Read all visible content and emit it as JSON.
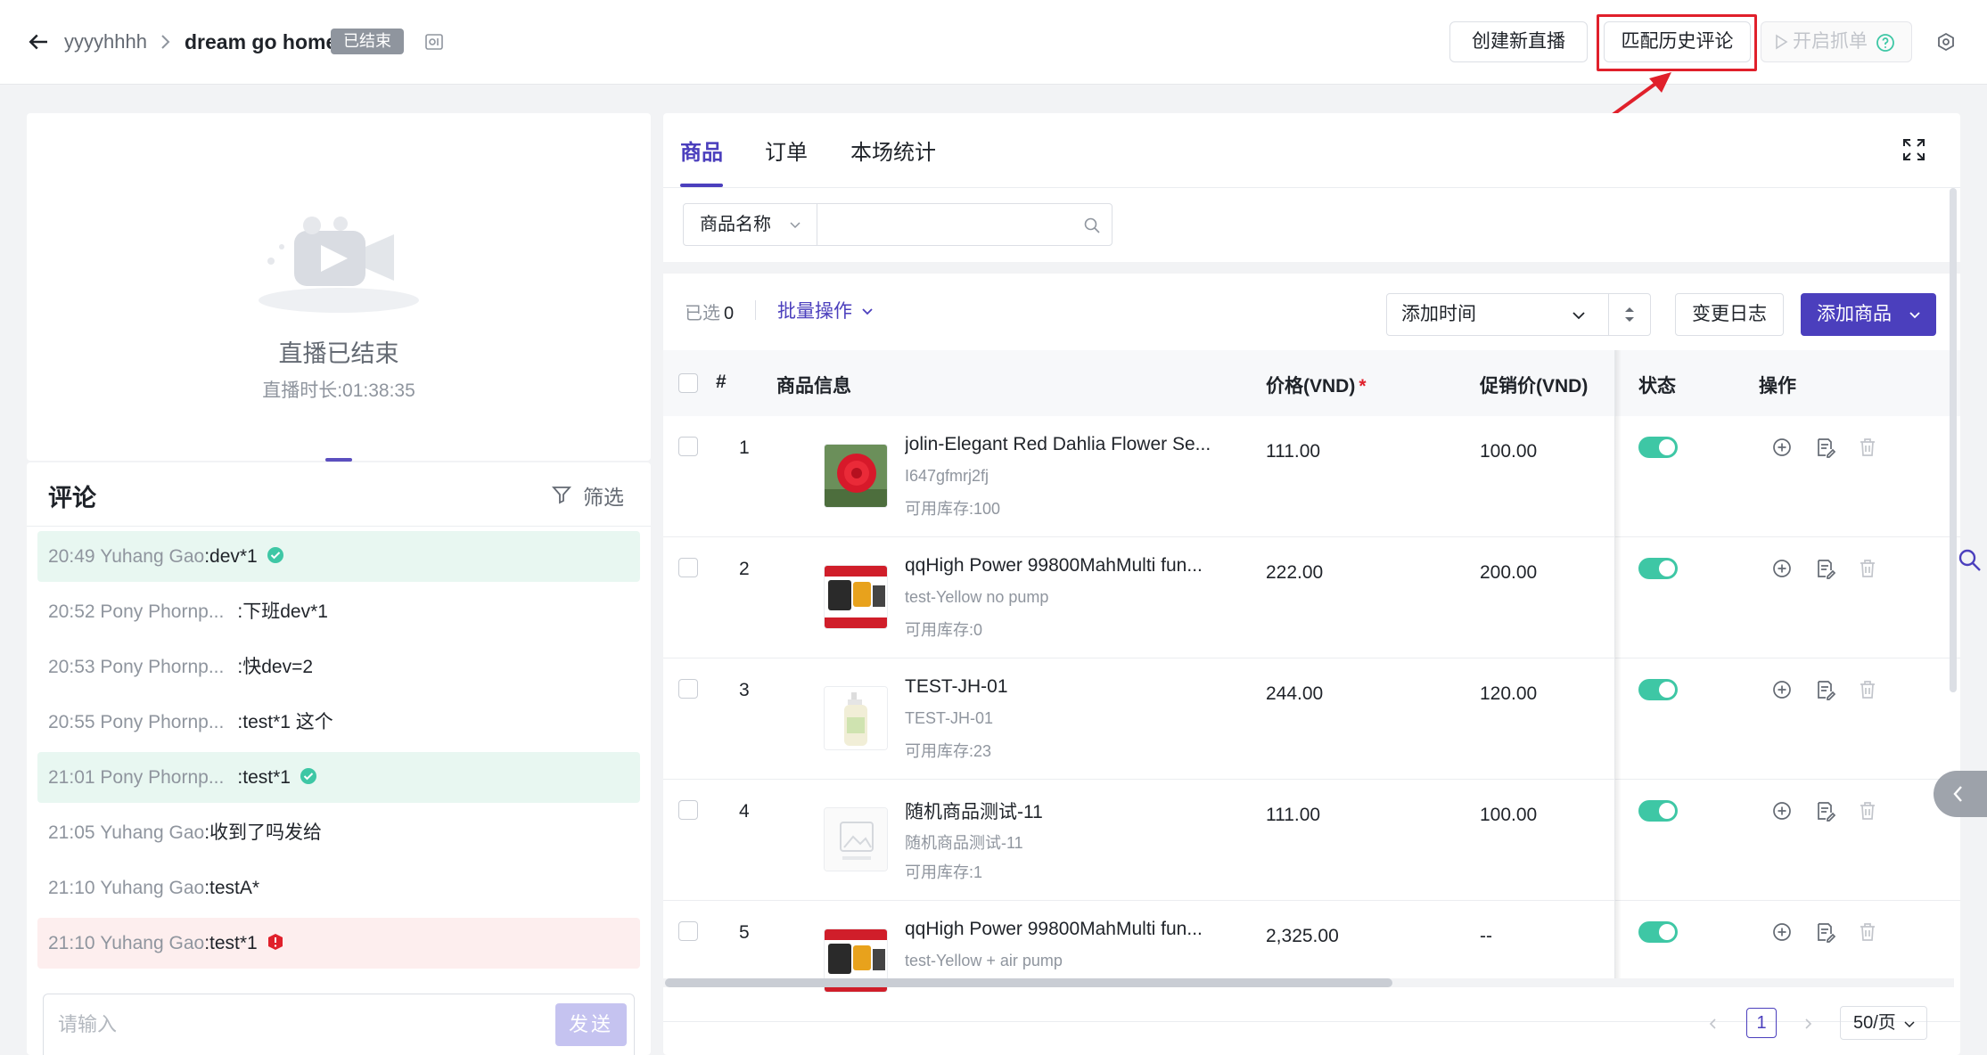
{
  "header": {
    "user": "yyyyhhhh",
    "title": "dream go home",
    "status": "已结束",
    "buttons": {
      "create": "创建新直播",
      "match": "匹配历史评论",
      "capture": "开启抓单"
    }
  },
  "video": {
    "ended": "直播已结束",
    "duration_label": "直播时长:",
    "duration": "01:38:35"
  },
  "comments": {
    "title": "评论",
    "filter": "筛选",
    "items": [
      {
        "time": "20:49",
        "name": "Yuhang Gao",
        "text": ":dev*1",
        "state": "ok"
      },
      {
        "time": "20:52",
        "name": "Pony Phornp...",
        "text": ":下班dev*1",
        "state": ""
      },
      {
        "time": "20:53",
        "name": "Pony Phornp...",
        "text": ":快dev=2",
        "state": ""
      },
      {
        "time": "20:55",
        "name": "Pony Phornp...",
        "text": ":test*1 这个",
        "state": ""
      },
      {
        "time": "21:01",
        "name": "Pony Phornp...",
        "text": ":test*1",
        "state": "ok"
      },
      {
        "time": "21:05",
        "name": "Yuhang Gao",
        "text": ":收到了吗发给",
        "state": ""
      },
      {
        "time": "21:10",
        "name": "Yuhang Gao",
        "text": ":testA*",
        "state": ""
      },
      {
        "time": "21:10",
        "name": "Yuhang Gao",
        "text": ":test*1",
        "state": "err"
      }
    ],
    "input_placeholder": "请输入",
    "send": "发送"
  },
  "tabs": [
    "商品",
    "订单",
    "本场统计"
  ],
  "search": {
    "field": "商品名称",
    "value": ""
  },
  "toolbar": {
    "selected_label": "已选",
    "selected_count": "0",
    "bulk": "批量操作",
    "sort": "添加时间",
    "log": "变更日志",
    "add": "添加商品"
  },
  "table": {
    "headers": {
      "index": "#",
      "info": "商品信息",
      "price": "价格(VND)",
      "promo": "促销价(VND)",
      "status": "状态",
      "ops": "操作"
    },
    "rows": [
      {
        "index": "1",
        "name": "jolin-Elegant Red Dahlia Flower Se...",
        "sku": "I647gfmrj2fj",
        "stock": "可用库存:100",
        "price": "111.00",
        "promo": "100.00",
        "thumb": "flower"
      },
      {
        "index": "2",
        "name": "qqHigh Power 99800MahMulti fun...",
        "sku": "test-Yellow no pump",
        "stock": "可用库存:0",
        "price": "222.00",
        "promo": "200.00",
        "thumb": "device"
      },
      {
        "index": "3",
        "name": "TEST-JH-01",
        "sku": "TEST-JH-01",
        "stock": "可用库存:23",
        "price": "244.00",
        "promo": "120.00",
        "thumb": "bottle"
      },
      {
        "index": "4",
        "name": "随机商品测试-11",
        "sku": "随机商品测试-11",
        "stock": "可用库存:1",
        "price": "111.00",
        "promo": "100.00",
        "thumb": "noimage"
      },
      {
        "index": "5",
        "name": "qqHigh Power 99800MahMulti fun...",
        "sku": "test-Yellow + air pump",
        "stock": "",
        "price": "2,325.00",
        "promo": "--",
        "thumb": "device"
      }
    ]
  },
  "pager": {
    "current": "1",
    "size": "50/页"
  },
  "colors": {
    "accent": "#4b3fbd",
    "success": "#3ec7a5",
    "danger": "#e0202b"
  }
}
